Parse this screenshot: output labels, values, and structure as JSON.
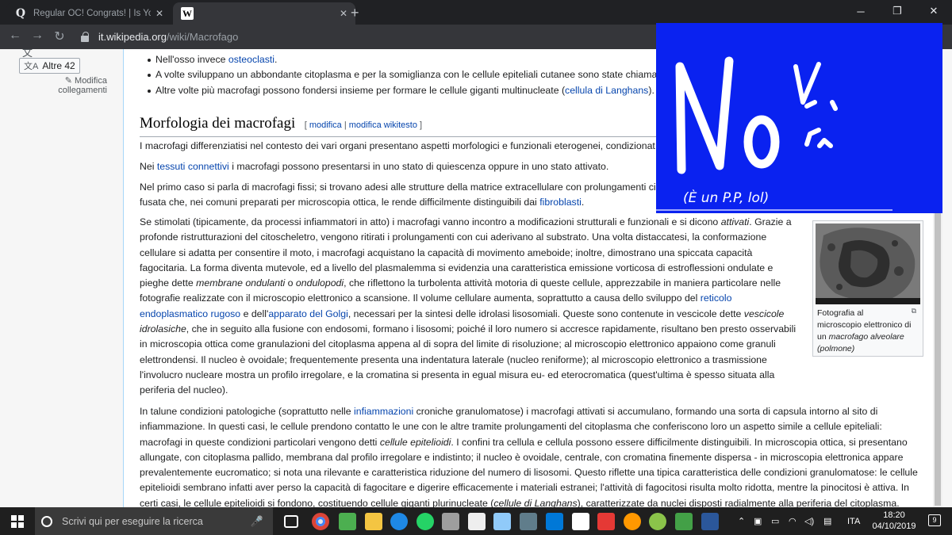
{
  "browser": {
    "tabs": [
      {
        "title": "Regular OC! Congrats! | Is Your A",
        "favicon": "quora-icon"
      },
      {
        "title": "",
        "favicon": "wikipedia-icon"
      }
    ],
    "url_domain": "it.wikipedia.org",
    "url_path": "/wiki/Macrofago"
  },
  "sidebar": {
    "lang_button": "Altre 42",
    "edit_links": "Modifica collegamenti"
  },
  "article": {
    "bullets": [
      {
        "pre": "Nell'osso invece ",
        "link": "osteoclasti",
        "post": "."
      },
      {
        "pre": "A volte sviluppano un abbondante citoplasma e per la somiglianza con le cellule epiteliali cutanee sono state chiama",
        "link": "",
        "post": ""
      },
      {
        "pre": "Altre volte più macrofagi possono fondersi insieme per formare le cellule giganti multinucleate (",
        "link": "cellula di Langhans",
        "post": ")."
      }
    ],
    "heading": "Morfologia dei macrofagi",
    "heading_edit_open": "[ ",
    "heading_edit_1": "modifica",
    "heading_edit_sep": " | ",
    "heading_edit_2": "modifica wikitesto",
    "heading_edit_close": " ]",
    "p1": "I macrofagi differenziatisi nel contesto dei vari organi presentano aspetti morfologici e funzionali eterogenei, condizionat",
    "p2_pre": "Nei ",
    "p2_link": "tessuti connettivi",
    "p2_post": " i macrofagi possono presentarsi in uno stato di quiescenza oppure in uno stato attivato.",
    "p3_a": "Nel primo caso si parla di macrofagi fissi; si trovano adesi alle strutture della matrice extracellulare con prolungamenti ci",
    "p3_b": "fusata che, nei comuni preparati per microscopia ottica, le rende difficilmente distinguibili dai ",
    "p3_link": "fibroblasti",
    "p3_end": ".",
    "p4_1": "Se stimolati (tipicamente, da processi infiammatori in atto) i macrofagi vanno incontro a modificazioni strutturali e funzionali e si dicono ",
    "p4_1i": "attivati",
    "p4_1b": ". Grazie a",
    "p4_2": "profonde ristrutturazioni del citoscheletro, vengono ritirati i prolungamenti con cui aderivano al substrato. Una volta distaccatesi, la conformazione",
    "p4_3": "cellulare si adatta per consentire il moto, i macrofagi acquistano la capacità di movimento ameboide; inoltre, dimostrano una spiccata capacità",
    "p4_4": "fagocitaria. La forma diventa mutevole, ed a livello del plasmalemma si evidenzia una caratteristica emissione vorticosa di estroflessioni ondulate e",
    "p4_5a": "pieghe dette ",
    "p4_5i1": "membrane ondulanti",
    "p4_5b": " o ",
    "p4_5i2": "ondulopodi",
    "p4_5c": ", che riflettono la turbolenta attività motoria di queste cellule, apprezzabile in maniera particolare nelle",
    "p4_6a": "fotografie realizzate con il microscopio elettronico a scansione. Il volume cellulare aumenta, soprattutto a causa dello sviluppo del ",
    "p4_6link": "reticolo",
    "p4_7link1": "endoplasmatico rugoso",
    "p4_7a": " e dell'",
    "p4_7link2": "apparato del Golgi",
    "p4_7b": ", necessari per la sintesi delle idrolasi lisosomiali. Queste sono contenute in vescicole dette ",
    "p4_7i": "vescicole",
    "p4_8i": "idrolasiche",
    "p4_8": ", che in seguito alla fusione con endosomi, formano i lisosomi; poiché il loro numero si accresce rapidamente, risultano ben presto osservabili",
    "p4_9": "in microscopia ottica come granulazioni del citoplasma appena al di sopra del limite di risoluzione; al microscopio elettronico appaiono come granuli",
    "p4_10": "elettrondensi. Il nucleo è ovoidale; frequentemente presenta una indentatura laterale (nucleo reniforme); al microscopio elettronico a trasmissione",
    "p4_11": "l'involucro nucleare mostra un profilo irregolare, e la cromatina si presenta in egual misura eu- ed eterocromatica (quest'ultima è spesso situata alla",
    "p4_12": "periferia del nucleo).",
    "p5_1a": "In talune condizioni patologiche (soprattutto nelle ",
    "p5_1link": "infiammazioni",
    "p5_1b": " croniche granulomatose) i macrofagi attivati si accumulano, formando una sorta di capsula intorno al sito di",
    "p5_2": "infiammazione. In questi casi, le cellule prendono contatto le une con le altre tramite prolungamenti del citoplasma che conferiscono loro un aspetto simile a cellule epiteliali:",
    "p5_3a": "macrofagi in queste condizioni particolari vengono detti ",
    "p5_3i": "cellule epitelioidi",
    "p5_3b": ". I confini tra cellula e cellula possono essere difficilmente distinguibili. In microscopia ottica, si presentano",
    "p5_4": "allungate, con citoplasma pallido, membrana dal profilo irregolare e indistinto; il nucleo è ovoidale, centrale, con cromatina finemente dispersa - in microscopia elettronica appare",
    "p5_5": "prevalentemente eucromatico; si nota una rilevante e caratteristica riduzione del numero di lisosomi. Questo riflette una tipica caratteristica delle condizioni granulomatose: le cellule",
    "p5_6": "epitelioidi sembrano infatti aver perso la capacità di fagocitare e digerire efficacemente i materiali estranei; l'attività di fagocitosi risulta molto ridotta, mentre la pinocitosi è attiva. In",
    "p5_7a": "certi casi, le cellule epitelioidi si fondono, costituendo cellule giganti plurinucleate (",
    "p5_7i": "cellule di Langhans",
    "p5_7b": "), caratterizzate da nuclei disposti radialmente alla periferia del citoplasma."
  },
  "figure": {
    "cap_1": "Fotografia al",
    "cap_2": "microscopio elettronico di",
    "cap_3a": "un ",
    "cap_3i": "macrofago alveolare",
    "cap_4": "(polmone)"
  },
  "overlay": {
    "big_text": "No",
    "small_text": "(È un P.P, lol)",
    "color": "#0a22f0"
  },
  "taskbar": {
    "search_placeholder": "Scrivi qui per eseguire la ricerca",
    "language": "ITA",
    "time": "18:20",
    "date": "04/10/2019",
    "notifications": "9"
  }
}
